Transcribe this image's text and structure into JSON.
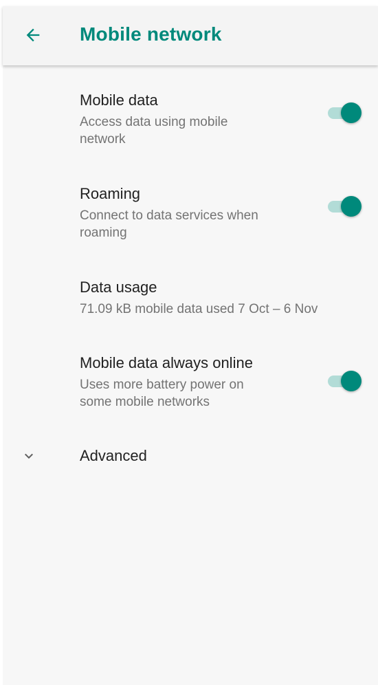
{
  "header": {
    "title": "Mobile network"
  },
  "settings": {
    "mobile_data": {
      "title": "Mobile data",
      "summary_line1": "Access data using mobile",
      "summary_line2": "network",
      "enabled": true
    },
    "roaming": {
      "title": "Roaming",
      "summary_line1": "Connect to data services when",
      "summary_line2": "roaming",
      "enabled": true
    },
    "data_usage": {
      "title": "Data usage",
      "summary": "71.09 kB mobile data used 7 Oct – 6 Nov"
    },
    "always_online": {
      "title": "Mobile data always online",
      "summary_line1": "Uses more battery power on",
      "summary_line2": "some mobile networks",
      "enabled": true
    },
    "advanced": {
      "title": "Advanced"
    }
  },
  "colors": {
    "accent": "#00897b",
    "track_on": "#b2dcd7",
    "background": "#f7f7f7"
  },
  "icons": {
    "back": "arrow-back-icon",
    "expand": "chevron-down-icon"
  }
}
